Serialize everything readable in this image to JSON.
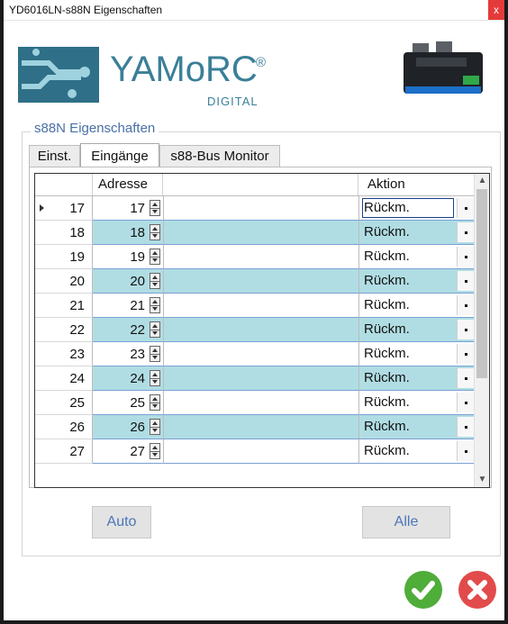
{
  "window": {
    "title": "YD6016LN-s88N Eigenschaften",
    "close_label": "x"
  },
  "logo": {
    "brand": "YAMoRC",
    "registered": "®",
    "sub": "DIGITAL"
  },
  "group": {
    "title": "s88N Eigenschaften"
  },
  "tabs": [
    {
      "label": "Einst."
    },
    {
      "label": "Eingänge"
    },
    {
      "label": "s88-Bus Monitor"
    }
  ],
  "grid": {
    "columns": {
      "addr": "Adresse",
      "action": "Aktion"
    },
    "rows": [
      {
        "num": "17",
        "addr": "17",
        "action": "Rückm."
      },
      {
        "num": "18",
        "addr": "18",
        "action": "Rückm."
      },
      {
        "num": "19",
        "addr": "19",
        "action": "Rückm."
      },
      {
        "num": "20",
        "addr": "20",
        "action": "Rückm."
      },
      {
        "num": "21",
        "addr": "21",
        "action": "Rückm."
      },
      {
        "num": "22",
        "addr": "22",
        "action": "Rückm."
      },
      {
        "num": "23",
        "addr": "23",
        "action": "Rückm."
      },
      {
        "num": "24",
        "addr": "24",
        "action": "Rückm."
      },
      {
        "num": "25",
        "addr": "25",
        "action": "Rückm."
      },
      {
        "num": "26",
        "addr": "26",
        "action": "Rückm."
      },
      {
        "num": "27",
        "addr": "27",
        "action": "Rückm."
      }
    ]
  },
  "buttons": {
    "auto": "Auto",
    "alle": "Alle"
  },
  "colors": {
    "alt_row": "#b0dde3",
    "ok": "#4fad3a",
    "cancel": "#e24b4b",
    "accent_text": "#4a76b8"
  }
}
